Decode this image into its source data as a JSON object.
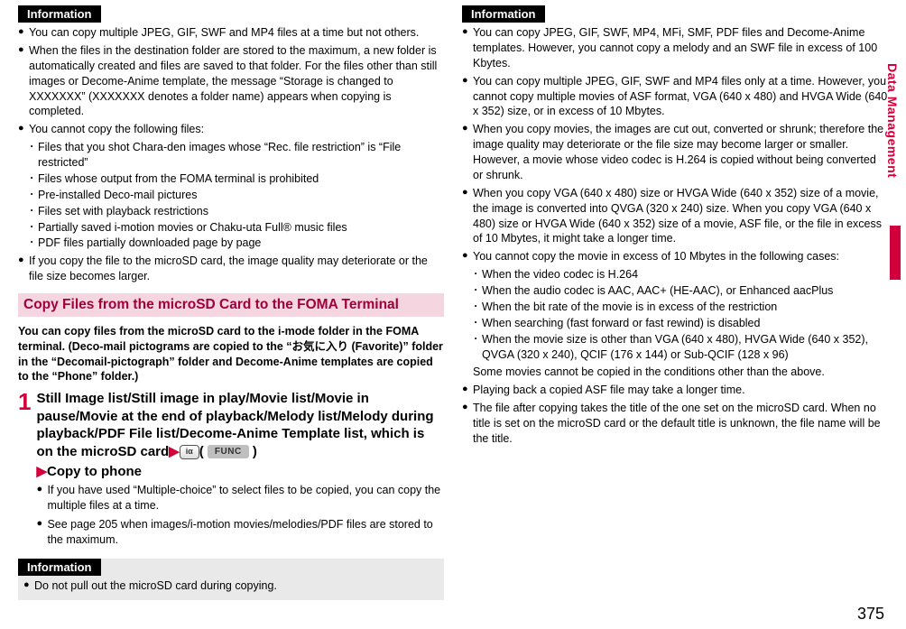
{
  "infoBadge": "Information",
  "sideLabel": "Data Management",
  "pageNumber": "375",
  "leftInfo": {
    "bullets": [
      "You can copy multiple JPEG, GIF, SWF and MP4 files at a time but not others.",
      "When the files in the destination folder are stored to the maximum, a new folder is automatically created and files are saved to that folder. For the files other than still images or Decome-Anime template, the message “Storage is changed to XXXXXXX” (XXXXXXX denotes a folder name) appears when copying is completed.",
      "You cannot copy the following files:"
    ],
    "subBullets": [
      "Files that you shot Chara-den images whose “Rec. file restriction” is “File restricted”",
      "Files whose output from the FOMA terminal is prohibited",
      "Pre-installed Deco-mail pictures",
      "Files set with playback restrictions",
      "Partially saved i-motion movies or Chaku-uta Full® music files",
      "PDF files partially downloaded page by page"
    ],
    "finalBullet": "If you copy the file to the microSD card, the image quality may deteriorate or the file size becomes larger."
  },
  "sectionTitle": "Copy Files from the microSD Card to the FOMA Terminal",
  "sectionIntro": "You can copy files from the microSD card to the i-mode folder in the FOMA terminal. (Deco-mail pictograms are copied to the “お気に入り (Favorite)” folder in the “Decomail-pictograph” folder and Decome-Anime templates are copied to the “Phone” folder.)",
  "step": {
    "num": "1",
    "titlePart1": "Still Image list/Still image in play/Movie list/Movie in pause/Movie at the end of playback/Melody list/Melody during playback/PDF File list/Decome-Anime Template list, which is on the microSD card",
    "funcLabel": "FUNC",
    "iconAlt": "iα",
    "copyLine": "Copy to phone",
    "notes": [
      "If you have used “Multiple-choice” to select files to be copied, you can copy the multiple files at a time.",
      "See page 205 when images/i-motion movies/melodies/PDF files are stored to the maximum."
    ]
  },
  "leftBoxInfo": {
    "bullets": [
      "Do not pull out the microSD card during copying."
    ]
  },
  "rightInfo": {
    "bullets1": [
      "You can copy JPEG, GIF, SWF, MP4, MFi, SMF, PDF files and Decome-Anime templates. However, you cannot copy a melody and an SWF file in excess of 100 Kbytes.",
      "You can copy multiple JPEG, GIF, SWF and MP4 files only at a time. However, you cannot copy multiple movies of ASF format, VGA (640 x 480) and HVGA Wide (640 x 352) size, or in excess of 10 Mbytes.",
      "When you copy movies, the images are cut out, converted or shrunk; therefore the image quality may deteriorate or the file size may become larger or smaller. However, a movie whose video codec is H.264 is copied without being converted or shrunk.",
      "When you copy VGA (640 x 480) size or HVGA Wide (640 x 352) size of a movie, the image is converted into QVGA (320 x 240) size. When you copy VGA (640 x 480) size or HVGA Wide (640 x 352) size of a movie, ASF file, or the file in excess of 10 Mbytes, it might take a longer time.",
      "You cannot copy the movie in excess of 10 Mbytes in the following cases:"
    ],
    "subBullets": [
      "When the video codec is H.264",
      "When the audio codec is AAC, AAC+ (HE-AAC), or Enhanced aacPlus",
      "When the bit rate of the movie is in excess of the restriction",
      "When searching (fast forward or fast rewind) is disabled",
      "When the movie size is other than VGA (640 x 480), HVGA Wide (640 x 352), QVGA (320 x 240), QCIF (176 x 144) or Sub-QCIF (128 x 96)"
    ],
    "afterSub": "Some movies cannot be copied in the conditions other than the above.",
    "bullets2": [
      "Playing back a copied ASF file may take a longer time.",
      "The file after copying takes the title of the one set on the microSD card. When no title is set on the microSD card or the default title is unknown, the file name will be the title."
    ]
  }
}
